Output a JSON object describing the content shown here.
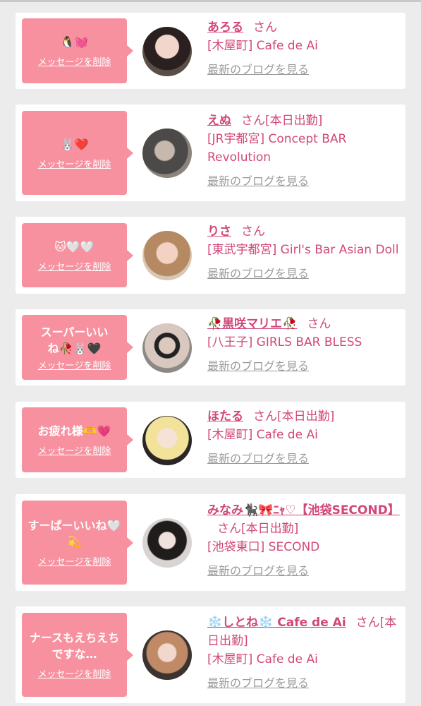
{
  "delete_label": "メッセージを削除",
  "blog_label": "最新のブログを見る",
  "san_label": "さん",
  "items": [
    {
      "message": "🐧💓",
      "name": "あろる",
      "status": "",
      "shop": "[木屋町] Cafe de Ai"
    },
    {
      "message": "🐰❤️",
      "name": "えぬ",
      "status": "[本日出勤]",
      "shop": "[JR宇都宮] Concept BAR Revolution"
    },
    {
      "message": "🐱🤍🤍",
      "name": "りさ",
      "status": "",
      "shop": "[東武宇都宮] Girl's Bar Asian Doll"
    },
    {
      "message": "スーパーいいね🥀🐰🖤",
      "name": "🥀黒咲マリエ🥀",
      "status": "",
      "shop": "[八王子] GIRLS BAR BLESS"
    },
    {
      "message": "お疲れ様🫶💗",
      "name": "ほたる",
      "status": "[本日出勤]",
      "shop": "[木屋町] Cafe de Ai"
    },
    {
      "message": "すーぱーいいね🤍💫",
      "name": "みなみ🐈‍⬛🎀ﾆｬ♡【池袋SECOND】",
      "status": "[本日出勤]",
      "shop": "[池袋東口] SECOND"
    },
    {
      "message": "ナースもえちえちですな…",
      "name": "❄️しとね❄️ Cafe de Ai",
      "status": "[本日出勤]",
      "shop": "[木屋町] Cafe de Ai"
    }
  ],
  "colors": {
    "accent": "#d2477a",
    "bubble": "#f7919f",
    "background": "#ececec"
  }
}
